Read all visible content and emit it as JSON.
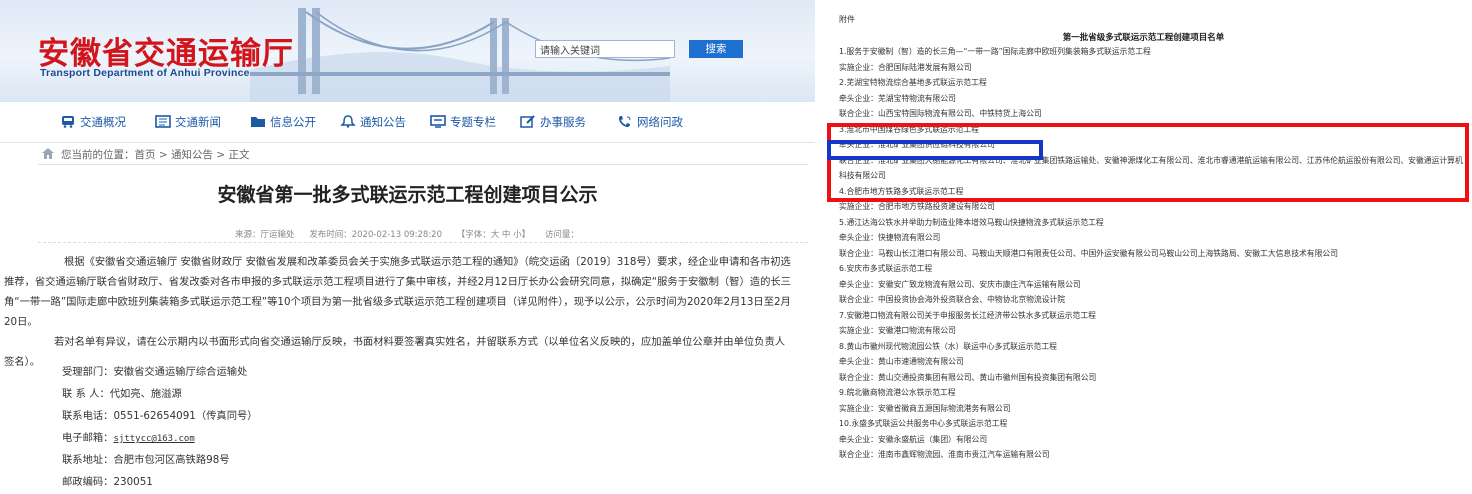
{
  "header": {
    "logo_cn": "安徽省交通运输厅",
    "logo_en": "Transport Department of Anhui Province",
    "search": {
      "placeholder": "请输入关键词",
      "button": "搜索"
    }
  },
  "nav": [
    {
      "label": "交通概况",
      "icon": "bus-icon"
    },
    {
      "label": "交通新闻",
      "icon": "newspaper-icon"
    },
    {
      "label": "信息公开",
      "icon": "folder-icon"
    },
    {
      "label": "通知公告",
      "icon": "bell-icon"
    },
    {
      "label": "专题专栏",
      "icon": "monitor-icon"
    },
    {
      "label": "办事服务",
      "icon": "edit-icon"
    },
    {
      "label": "网络问政",
      "icon": "chat-icon"
    }
  ],
  "breadcrumb": "您当前的位置：首页 > 通知公告 > 正文",
  "article": {
    "title": "安徽省第一批多式联运示范工程创建项目公示",
    "source": "来源：厅运输处",
    "date": "发布时间：2020-02-13 09:28:20",
    "font": "【字体：大 中 小】",
    "visits": "访问量：",
    "paragraph1": "根据《安徽省交通运输厅 安徽省财政厅 安徽省发展和改革委员会关于实施多式联运示范工程的通知》（皖交运函〔2019〕318号）要求，经企业申请和各市初选推荐，省交通运输厅联合省财政厅、省发改委对各市申报的多式联运示范工程项目进行了集中审核，并经2月12日厅长办公会研究同意，拟确定“服务于安徽制（智）造的长三角“一带一路”国际走廊中欧班列集装箱多式联运示范工程”等10个项目为第一批省级多式联运示范工程创建项目（详见附件），现予以公示，公示时间为2020年2月13日至2月20日。",
    "paragraph2": "若对名单有异议，请在公示期内以书面形式向省交通运输厅反映，书面材料要签署真实姓名，并留联系方式（以单位名义反映的，应加盖单位公章并由单位负责人签名）。",
    "contacts": [
      "受理部门：安徽省交通运输厅综合运输处",
      "联 系 人：代如亮、施溢源",
      "联系电话：0551-62654091（传真同号）",
      "电子邮箱：",
      "联系地址：合肥市包河区高铁路98号",
      "邮政编码：230051"
    ],
    "email": "sjttycc@163.com"
  },
  "attachment": {
    "label": "附件",
    "title": "第一批省级多式联运示范工程创建项目名单",
    "lines": [
      "1.服务于安徽制（智）造的长三角—“一带一路”国际走廊中欧班列集装箱多式联运示范工程",
      "实施企业：合肥国际陆港发展有限公司",
      "2.芜湖宝特物流综合基地多式联运示范工程",
      "牵头企业：芜湖宝特物流有限公司",
      "联合企业：山西宝特国际物流有限公司、中铁特货上海公司",
      "3.淮北市中国煤谷绿色多式联运示范工程",
      "牵头企业：淮北矿业集团供应链科技有限公司",
      "联合企业：淮北矿业集团大榭能源化工有限公司、淮北矿业集团铁路运输处、安徽神源煤化工有限公司、淮北市睿通港航运输有限公司、江苏伟伦航运股份有限公司、安徽通运计算机科技有限公司",
      "4.合肥市地方铁路多式联运示范工程",
      "实施企业：合肥市地方铁路投资建设有限公司",
      "5.通江达海公铁水并举助力制造业降本增效马鞍山快捷物流多式联运示范工程",
      "牵头企业：快捷物流有限公司",
      "联合企业：马鞍山长江港口有限公司、马鞍山天顺港口有限责任公司、中国外运安徽有限公司马鞍山公司上海铁路局、安徽工大信息技术有限公司",
      "6.安庆市多式联运示范工程",
      "牵头企业：安徽安广致龙物流有限公司、安庆市康庄汽车运输有限公司",
      "联合企业：中国投资协会海外投资联合会、中物协北京物流设计院",
      "7.安徽港口物流有限公司关于申报服务长江经济带公铁水多式联运示范工程",
      "实施企业：安徽港口物流有限公司",
      "8.黄山市徽州现代物流园公铁（水）联运中心多式联运示范工程",
      "牵头企业：黄山市速通物流有限公司",
      "联合企业：黄山交通投资集团有限公司、黄山市徽州国有投资集团有限公司",
      "9.皖北徽商物流港公水铁示范工程",
      "实施企业：安徽省徽商五源国际物流港务有限公司",
      "10.永盛多式联运公共服务中心多式联运示范工程",
      "牵头企业：安徽永盛航运（集团）有限公司",
      "联合企业：淮南市鑫辉物流园、淮南市贵江汽车运输有限公司"
    ]
  },
  "colors": {
    "brand_red": "#d2141b",
    "nav_blue": "#1c5aa8",
    "highlight_red": "#ee1111",
    "highlight_blue": "#1537c8"
  }
}
